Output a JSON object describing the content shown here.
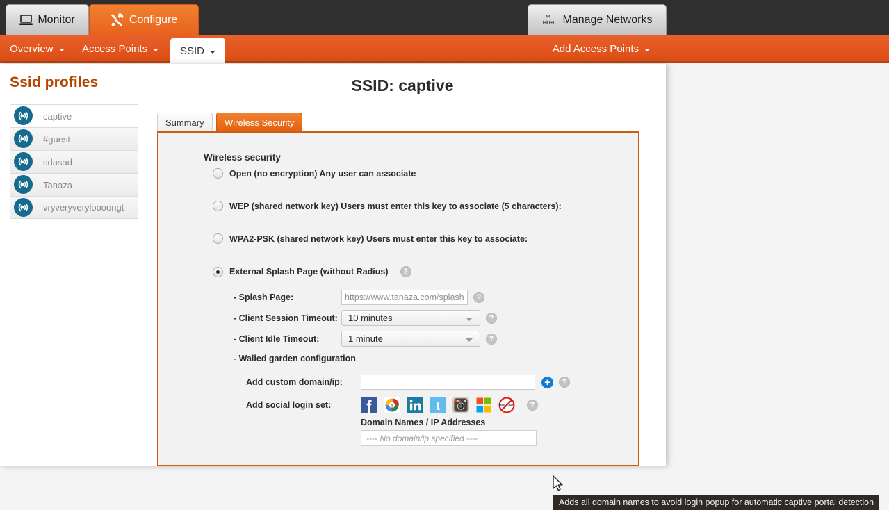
{
  "topbar": {
    "tabs": [
      {
        "label": "Monitor",
        "icon": "monitor-icon",
        "active": false
      },
      {
        "label": "Configure",
        "icon": "tools-icon",
        "active": true
      }
    ],
    "manage_networks": {
      "label": "Manage Networks",
      "icon": "network-antenna-icon"
    }
  },
  "navbar": {
    "items": [
      {
        "label": "Overview",
        "has_caret": true,
        "selected": false
      },
      {
        "label": "Access Points",
        "has_caret": true,
        "selected": false
      },
      {
        "label": "SSID",
        "has_caret": true,
        "selected": true
      }
    ],
    "add_access_points": {
      "label": "Add Access Points",
      "has_caret": true
    }
  },
  "sidebar": {
    "title": "Ssid profiles",
    "items": [
      {
        "label": "captive",
        "icon": "wifi-icon"
      },
      {
        "label": "#guest",
        "icon": "wifi-icon"
      },
      {
        "label": "sdasad",
        "icon": "wifi-icon"
      },
      {
        "label": "Tanaza",
        "icon": "wifi-icon"
      },
      {
        "label": "vryveryveryloooongt",
        "icon": "wifi-icon"
      }
    ]
  },
  "main": {
    "page_title": "SSID: captive",
    "tabs": [
      {
        "label": "Summary",
        "active": false
      },
      {
        "label": "Wireless Security",
        "active": true
      }
    ],
    "section_heading": "Wireless security",
    "security_options": [
      {
        "id": "open",
        "label": "Open (no encryption) Any user can associate",
        "checked": false
      },
      {
        "id": "wep",
        "label": "WEP (shared network key) Users must enter this key to associate (5 characters):",
        "checked": false
      },
      {
        "id": "wpa2psk",
        "label": "WPA2-PSK (shared network key) Users must enter this key to associate:",
        "checked": false
      },
      {
        "id": "external-splash",
        "label": "External Splash Page (without Radius)",
        "checked": true,
        "help": "help-icon"
      }
    ],
    "splash_page": {
      "label": "- Splash Page:",
      "value": "https://www.tanaza.com/splashpa",
      "help": "help-icon"
    },
    "session_timeout": {
      "label": "- Client Session Timeout:",
      "value": "10 minutes",
      "help": "help-icon"
    },
    "idle_timeout": {
      "label": "- Client Idle Timeout:",
      "value": "1 minute",
      "help": "help-icon"
    },
    "walled_garden": {
      "heading": "- Walled garden configuration",
      "custom_domain": {
        "label": "Add custom domain/ip:",
        "value": "",
        "placeholder": "",
        "add_icon": "plus-icon",
        "help": "help-icon"
      },
      "social_login": {
        "label": "Add social login set:",
        "icons": [
          {
            "name": "facebook-icon",
            "title": "Facebook"
          },
          {
            "name": "google-plus-icon",
            "title": "Google+"
          },
          {
            "name": "linkedin-icon",
            "title": "LinkedIn"
          },
          {
            "name": "twitter-icon",
            "title": "Twitter"
          },
          {
            "name": "instagram-icon",
            "title": "Instagram"
          },
          {
            "name": "microsoft-icon",
            "title": "Microsoft"
          },
          {
            "name": "no-popups-icon",
            "title": "POPUPS"
          }
        ],
        "help": "help-icon"
      },
      "domain_list": {
        "title": "Domain Names / IP Addresses",
        "empty_text": "---- No domain/ip specified ----"
      }
    }
  },
  "tooltip": {
    "text": "Adds all domain names to avoid login popup for automatic captive portal detection"
  },
  "colors": {
    "brand_orange": "#e4600f",
    "dark_header": "#2f2f2f",
    "sidebar_title": "#b34700",
    "panel_border": "#cf5a11",
    "wifi_badge": "#156a8e",
    "plus_blue": "#1279d6"
  }
}
